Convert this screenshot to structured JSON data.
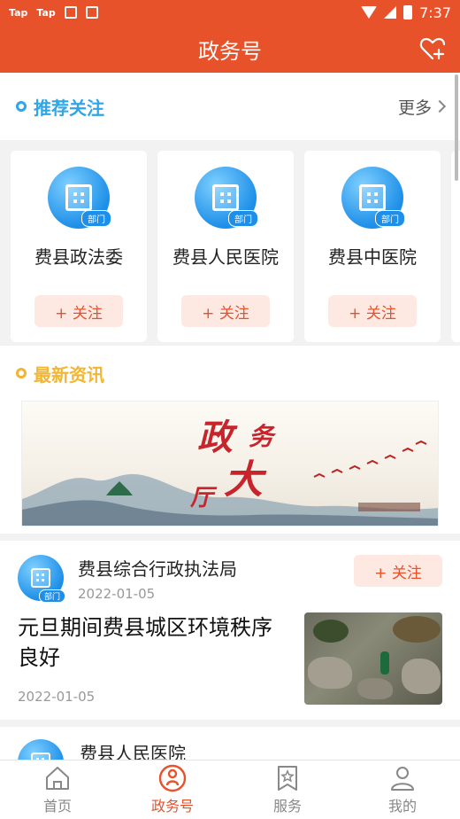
{
  "status_bar": {
    "left_icons": [
      "Tap",
      "Tap",
      "app-icon",
      "a-icon"
    ],
    "time": "7:37"
  },
  "header": {
    "title": "政务号",
    "action_icon": "heart-add-icon"
  },
  "recommend": {
    "title": "推荐关注",
    "more_label": "更多",
    "cards": [
      {
        "name": "费县政法委",
        "badge": "部门",
        "follow_label": "+ 关注"
      },
      {
        "name": "费县人民医院",
        "badge": "部门",
        "follow_label": "+ 关注"
      },
      {
        "name": "费县中医院",
        "badge": "部门",
        "follow_label": "+ 关注"
      }
    ]
  },
  "news": {
    "title": "最新资讯",
    "banner_text": [
      "政",
      "务",
      "大",
      "厅"
    ],
    "articles": [
      {
        "source": "费县综合行政执法局",
        "badge": "部门",
        "source_date": "2022-01-05",
        "follow_label": "+ 关注",
        "title": "元旦期间费县城区环境秩序良好",
        "date": "2022-01-05"
      },
      {
        "source": "费县人民医院"
      }
    ]
  },
  "tabbar": {
    "items": [
      {
        "label": "首页",
        "icon": "home-icon",
        "active": false
      },
      {
        "label": "政务号",
        "icon": "gov-account-icon",
        "active": true
      },
      {
        "label": "服务",
        "icon": "service-star-icon",
        "active": false
      },
      {
        "label": "我的",
        "icon": "profile-icon",
        "active": false
      }
    ]
  },
  "colors": {
    "primary": "#e8522b",
    "accent_blue": "#2fa6e8",
    "accent_yellow": "#f2b632"
  }
}
